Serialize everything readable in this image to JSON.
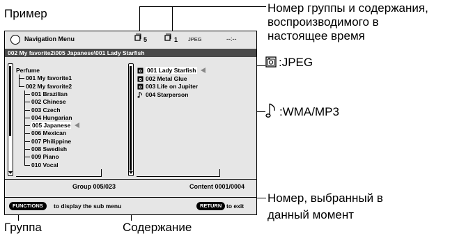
{
  "annotations": {
    "example": "Пример",
    "group_content_number": "Номер группы и содержания,",
    "group_content_number_2": "воспроизводимого в",
    "group_content_number_3": "настоящее время",
    "jpeg": ":JPEG",
    "wma_mp3": ":WMA/MP3",
    "selected_number": "Номер, выбранный в",
    "selected_number_2": "данный момент",
    "group": "Группа",
    "content": "Содержание"
  },
  "screen": {
    "title": "Navigation Menu",
    "group_count": "5",
    "content_count": "1",
    "format": "JPEG",
    "time": "--:--",
    "path": "002 My favorite2\\005 Japanese\\001 Lady Starfish",
    "tree": [
      {
        "label": "Perfume",
        "level": 0
      },
      {
        "label": "001 My favorite1",
        "level": 1
      },
      {
        "label": "002 My favorite2",
        "level": 1
      },
      {
        "label": "001 Brazilian",
        "level": 2
      },
      {
        "label": "002 Chinese",
        "level": 2
      },
      {
        "label": "003 Czech",
        "level": 2
      },
      {
        "label": "004 Hungarian",
        "level": 2
      },
      {
        "label": "005 Japanese",
        "level": 2,
        "selected": true
      },
      {
        "label": "006 Mexican",
        "level": 2
      },
      {
        "label": "007 Philippine",
        "level": 2
      },
      {
        "label": "008 Swedish",
        "level": 2
      },
      {
        "label": "009 Piano",
        "level": 2
      },
      {
        "label": "010 Vocal",
        "level": 2
      }
    ],
    "contents": [
      {
        "label": "001 Lady Starfish",
        "type": "jpeg",
        "selected": true
      },
      {
        "label": "002 Metal Glue",
        "type": "jpeg"
      },
      {
        "label": "003 Life on Jupiter",
        "type": "jpeg"
      },
      {
        "label": "004 Starperson",
        "type": "music"
      }
    ],
    "group_status": "Group 005/023",
    "content_status": "Content 0001/0004",
    "functions_label": "FUNCTIONS",
    "functions_text": "to display the sub menu",
    "return_label": "RETURN",
    "return_text": "to exit"
  }
}
